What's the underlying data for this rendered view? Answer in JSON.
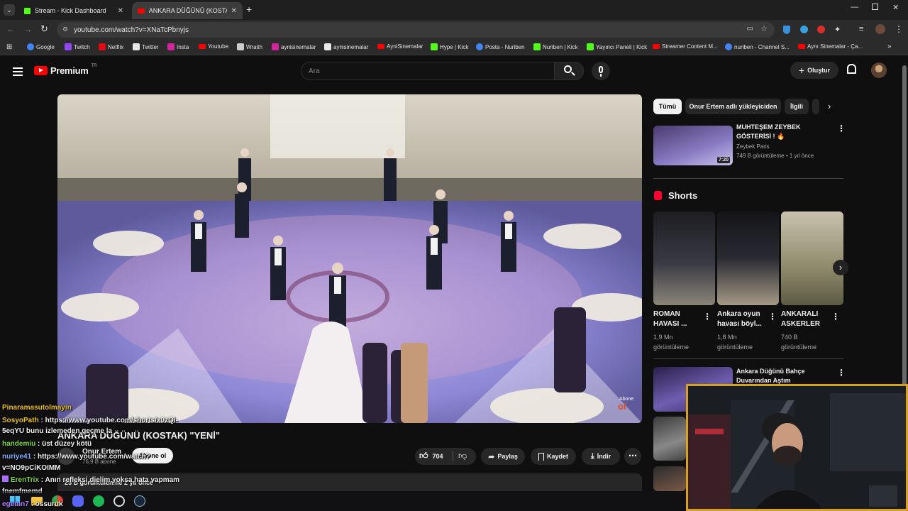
{
  "browser": {
    "tabs": [
      {
        "title": "Stream - Kick Dashboard",
        "icon": "kick-icon"
      },
      {
        "title": "ANKARA DÜĞÜNÜ (KOSTAK) \"YE",
        "icon": "youtube-icon"
      }
    ],
    "url": "youtube.com/watch?v=XNaTcPbnyjs",
    "bookmarks": [
      {
        "label": "Google",
        "color": "#4285f4"
      },
      {
        "label": "Twitch",
        "color": "#9146ff"
      },
      {
        "label": "Netflix",
        "color": "#e50914"
      },
      {
        "label": "Twitter",
        "color": "#e7e9ea"
      },
      {
        "label": "Insta",
        "color": "#d6249f"
      },
      {
        "label": "Youtube",
        "color": "#ff0000"
      },
      {
        "label": "Wraith",
        "color": "#cccccc"
      },
      {
        "label": "aynisinemalar",
        "color": "#d6249f"
      },
      {
        "label": "aynisinemalar",
        "color": "#e7e9ea"
      },
      {
        "label": "AyniSinemalar",
        "color": "#ff0000"
      },
      {
        "label": "Hype | Kick",
        "color": "#53fc18"
      },
      {
        "label": "Posta - Nuriben",
        "color": "#4285f4"
      },
      {
        "label": "Nuriben | Kick",
        "color": "#53fc18"
      },
      {
        "label": "Yayıncı Paneli | Kick",
        "color": "#53fc18"
      },
      {
        "label": "Streamer Content M...",
        "color": "#ff0000"
      },
      {
        "label": "nuriben - Channel S...",
        "color": "#4285f4"
      },
      {
        "label": "Aynı Sinemalar - Ça...",
        "color": "#ff0000"
      }
    ]
  },
  "header": {
    "logo": "Premium",
    "logo_sup": "TR",
    "search_placeholder": "Ara",
    "create_label": "Oluştur"
  },
  "video": {
    "title": "ANKARA DÜĞÜNÜ (KOSTAK) \"YENİ\"",
    "channel": "Onur Ertem",
    "subscribers": "76,9 B abone",
    "subscribe_label": "Abone ol",
    "likes": "704",
    "share_label": "Paylaş",
    "save_label": "Kaydet",
    "download_label": "İndir",
    "views_partial": "25 B görüntülenme  2 yıl önce",
    "watermark_top": "Abone",
    "watermark_bottom": "ol"
  },
  "sidebar": {
    "chips": [
      "Tümü",
      "Onur Ertem adlı yükleyiciden",
      "İlgili"
    ],
    "rec1": {
      "title_line1": "MUHTEŞEM ZEYBEK",
      "title_line2": "GÖSTERİSİ ! 🔥",
      "channel": "Zeybek Paris",
      "meta": "749 B görüntüleme • 1 yıl önce",
      "duration": "7:20"
    },
    "shorts_heading": "Shorts",
    "shorts": [
      {
        "line1": "ROMAN",
        "line2": "HAVASI ...",
        "views": "1,9 Mn",
        "views_label": "görüntüleme"
      },
      {
        "line1": "Ankara oyun",
        "line2": "havası böyl...",
        "views": "1,8 Mn",
        "views_label": "görüntüleme"
      },
      {
        "line1": "ANKARALI",
        "line2": "ASKERLER",
        "views": "740 B",
        "views_label": "görüntüleme"
      }
    ],
    "rec2": {
      "title_line1": "Ankara Düğünü  Bahçe",
      "title_line2": "Duvarından Aştım"
    }
  },
  "chat": [
    {
      "user": "Pinaramasutolmayın",
      "color": "#f0c419",
      "message": ""
    },
    {
      "user": "SosyoPath",
      "color": "#f0c419",
      "message": " : https://www.youtube.com/shorts/x0zQi-"
    },
    {
      "user": "",
      "color": "#ffffff",
      "message": "5eqYU bunu izlemeden geçme la"
    },
    {
      "user": "handemiu",
      "color": "#7cd63d",
      "message": " : üst düzey kötü"
    },
    {
      "user": "nuriye41",
      "color": "#7fb0ff",
      "message": " : https://www.youtube.com/watch?"
    },
    {
      "user": "",
      "color": "#ffffff",
      "message": "v=NO9pCiKOIMM"
    },
    {
      "user": "ErenTrix",
      "color": "#7cd63d",
      "message": " : Anın refleksi dielim yoksa hata yapmam"
    },
    {
      "user": "",
      "color": "#ffffff",
      "message": "fnemfmemd"
    },
    {
      "user": "egemn7",
      "color": "#b07cff",
      "message": " : ossuruk"
    }
  ]
}
